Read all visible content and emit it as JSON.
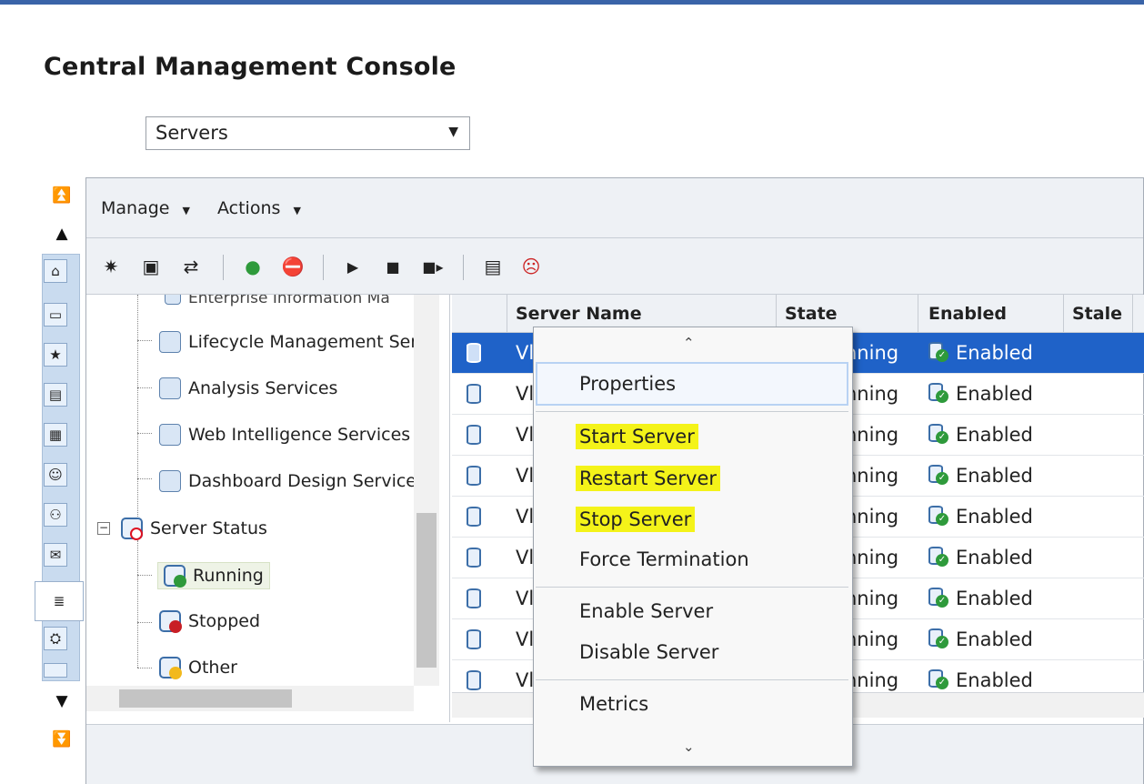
{
  "app": {
    "title": "Central Management Console"
  },
  "nav": {
    "selected": "Servers"
  },
  "menubar": {
    "manage": "Manage",
    "actions": "Actions"
  },
  "tree": {
    "items": [
      {
        "label": "Enterprise Information Ma"
      },
      {
        "label": "Lifecycle Management Ser"
      },
      {
        "label": "Analysis Services"
      },
      {
        "label": "Web Intelligence Services"
      },
      {
        "label": "Dashboard Design Service"
      },
      {
        "label": "Server Status"
      },
      {
        "label": "Running"
      },
      {
        "label": "Stopped"
      },
      {
        "label": "Other"
      }
    ]
  },
  "grid": {
    "columns": [
      "Server Name",
      "State",
      "Enabled",
      "Stale"
    ],
    "rows": [
      {
        "name": "Vl",
        "state": "nning",
        "enabled": "Enabled",
        "stale": ""
      },
      {
        "name": "Vl",
        "state": "nning",
        "enabled": "Enabled",
        "stale": ""
      },
      {
        "name": "Vl",
        "state": "nning",
        "enabled": "Enabled",
        "stale": ""
      },
      {
        "name": "Vl",
        "state": "nning",
        "enabled": "Enabled",
        "stale": ""
      },
      {
        "name": "Vl",
        "state": "nning",
        "enabled": "Enabled",
        "stale": ""
      },
      {
        "name": "Vl",
        "state": "nning",
        "enabled": "Enabled",
        "stale": ""
      },
      {
        "name": "Vl",
        "state": "nning",
        "enabled": "Enabled",
        "stale": ""
      },
      {
        "name": "Vl",
        "state": "nning",
        "enabled": "Enabled",
        "stale": ""
      },
      {
        "name": "Vl",
        "state": "nning",
        "enabled": "Enabled",
        "stale": ""
      }
    ]
  },
  "context_menu": {
    "items": [
      "Properties",
      "Start Server",
      "Restart Server",
      "Stop Server",
      "Force Termination",
      "Enable Server",
      "Disable Server",
      "Metrics"
    ],
    "highlight_color": "#f4f319"
  },
  "colors": {
    "selection": "#1f62c8",
    "accent": "#3a64a8"
  }
}
